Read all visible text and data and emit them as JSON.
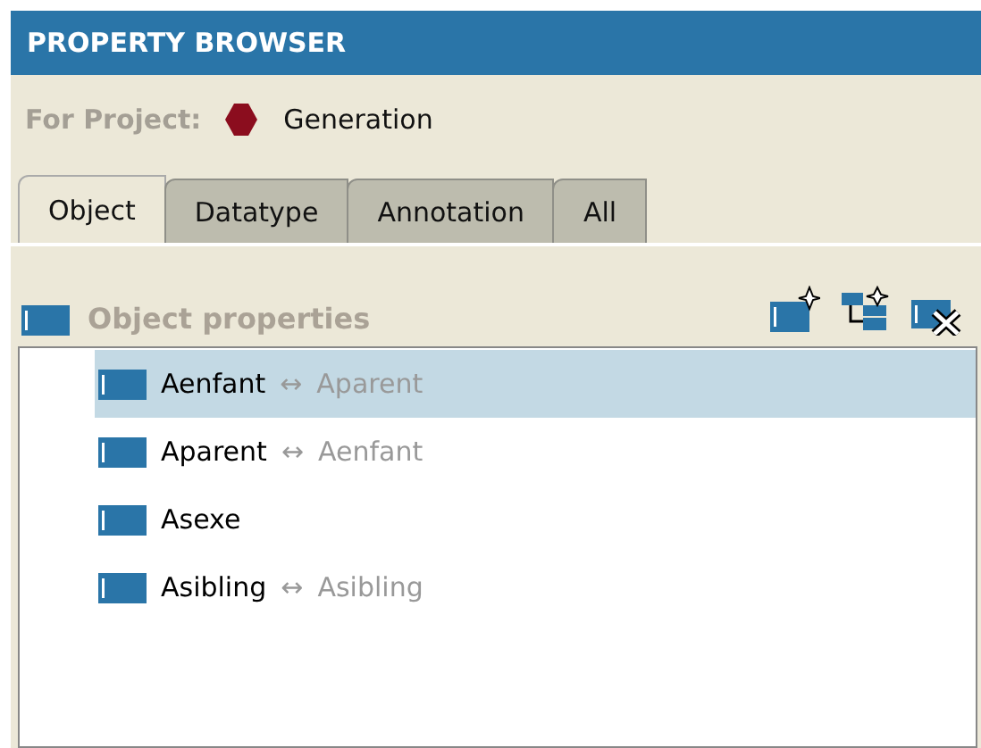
{
  "window": {
    "title": "PROPERTY BROWSER"
  },
  "project": {
    "label": "For Project:",
    "name": "Generation"
  },
  "tabs": [
    {
      "label": "Object",
      "selected": true
    },
    {
      "label": "Datatype",
      "selected": false
    },
    {
      "label": "Annotation",
      "selected": false
    },
    {
      "label": "All",
      "selected": false
    }
  ],
  "section": {
    "title": "Object properties"
  },
  "properties": [
    {
      "name": "Aenfant",
      "arrow": "↔",
      "inverse": "Aparent",
      "selected": true
    },
    {
      "name": "Aparent",
      "arrow": "↔",
      "inverse": "Aenfant",
      "selected": false
    },
    {
      "name": "Asexe",
      "selected": false
    },
    {
      "name": "Asibling",
      "arrow": "↔",
      "inverse": "Asibling",
      "selected": false
    }
  ]
}
